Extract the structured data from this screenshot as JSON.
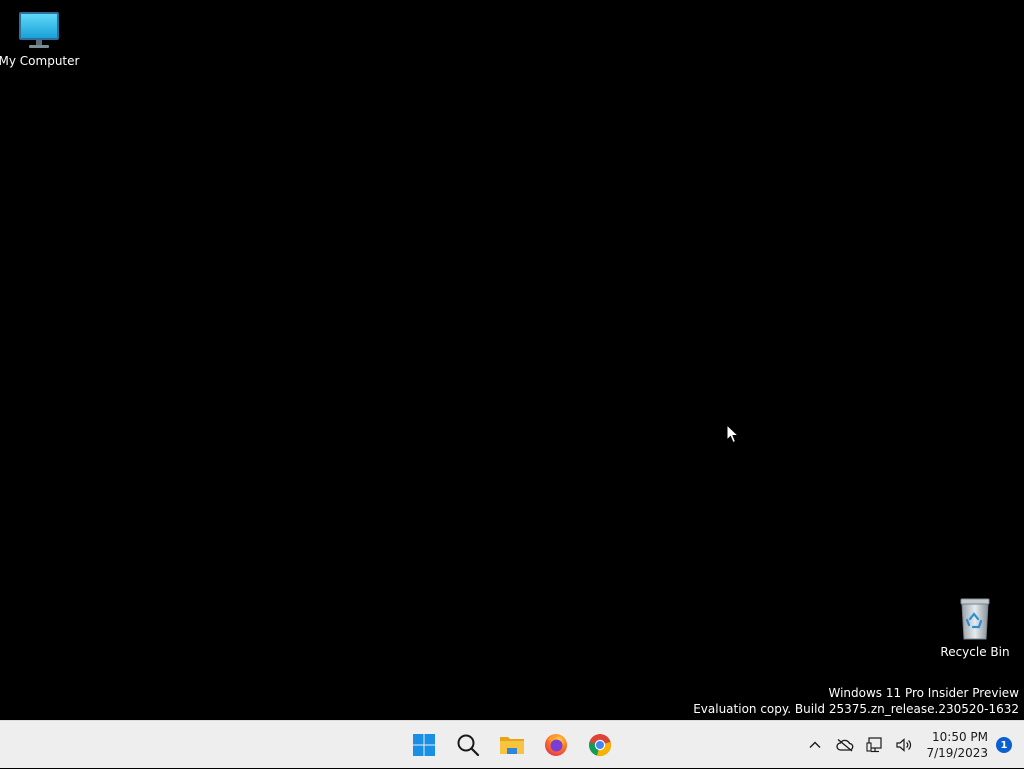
{
  "desktop": {
    "icons": [
      {
        "label": "My Computer",
        "icon": "monitor-icon"
      },
      {
        "label": "Recycle Bin",
        "icon": "recycle-bin-icon"
      }
    ],
    "watermark": {
      "line1": "Windows 11 Pro Insider Preview",
      "line2": "Evaluation copy. Build 25375.zn_release.230520-1632"
    }
  },
  "taskbar": {
    "apps": [
      {
        "name": "Start",
        "icon": "windows-logo-icon"
      },
      {
        "name": "Search",
        "icon": "search-icon"
      },
      {
        "name": "File Explorer",
        "icon": "folder-icon"
      },
      {
        "name": "Firefox",
        "icon": "firefox-icon"
      },
      {
        "name": "Chrome",
        "icon": "chrome-icon"
      }
    ],
    "tray": {
      "time": "10:50 PM",
      "date": "7/19/2023",
      "notification_count": "1",
      "icons": [
        "chevron-up-icon",
        "cloud-offline-icon",
        "network-icon",
        "volume-icon"
      ]
    }
  },
  "colors": {
    "desktop_bg": "#000000",
    "taskbar_bg": "#eeeeee",
    "accent": "#0a5fd1"
  }
}
